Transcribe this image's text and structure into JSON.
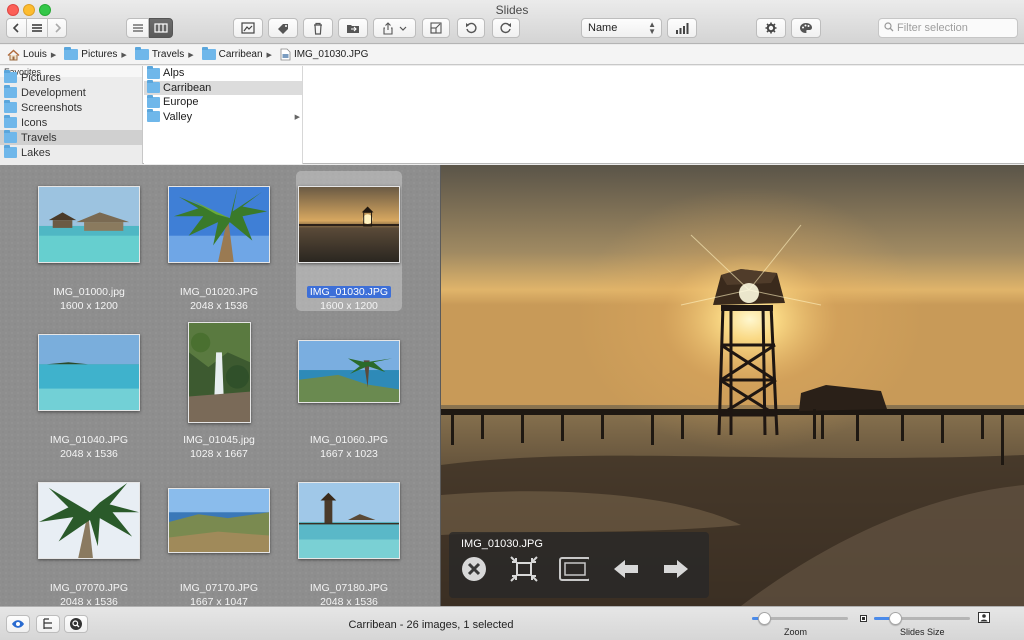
{
  "window": {
    "title": "Slides"
  },
  "toolbar": {
    "sort": {
      "selected": "Name"
    },
    "filter_placeholder": "Filter selection"
  },
  "path": [
    {
      "label": "Louis",
      "icon": "home-icon"
    },
    {
      "label": "Pictures",
      "icon": "folder-icon"
    },
    {
      "label": "Travels",
      "icon": "folder-icon"
    },
    {
      "label": "Carribean",
      "icon": "folder-icon"
    },
    {
      "label": "IMG_01030.JPG",
      "icon": "image-file-icon"
    }
  ],
  "sidebar": {
    "header": "Favorites",
    "items": [
      {
        "label": "Pictures"
      },
      {
        "label": "Development"
      },
      {
        "label": "Screenshots"
      },
      {
        "label": "Icons"
      },
      {
        "label": "Travels",
        "selected": true
      },
      {
        "label": "Lakes"
      }
    ]
  },
  "column": {
    "items": [
      {
        "label": "Alps"
      },
      {
        "label": "Carribean",
        "selected": true
      },
      {
        "label": "Europe"
      },
      {
        "label": "Valley",
        "has_children": true
      }
    ]
  },
  "images": [
    {
      "name": "IMG_01000.jpg",
      "size": "1600 x 1200"
    },
    {
      "name": "IMG_01020.JPG",
      "size": "2048 x 1536"
    },
    {
      "name": "IMG_01030.JPG",
      "size": "1600 x 1200",
      "selected": true
    },
    {
      "name": "IMG_01040.JPG",
      "size": "2048 x 1536"
    },
    {
      "name": "IMG_01045.jpg",
      "size": "1028 x 1667"
    },
    {
      "name": "IMG_01060.JPG",
      "size": "1667 x 1023"
    },
    {
      "name": "IMG_07070.JPG",
      "size": "2048 x 1536"
    },
    {
      "name": "IMG_07170.JPG",
      "size": "1667 x 1047"
    },
    {
      "name": "IMG_07180.JPG",
      "size": "2048 x 1536"
    }
  ],
  "preview": {
    "hud_title": "IMG_01030.JPG"
  },
  "bottom": {
    "status": "Carribean - 26 images, 1 selected",
    "zoom_label": "Zoom",
    "zoom_level": 0.12,
    "slides_size_label": "Slides Size",
    "slides_size_level": 0.22
  },
  "colors": {
    "accent": "#3d6fd8",
    "folder": "#6fb7ea"
  }
}
